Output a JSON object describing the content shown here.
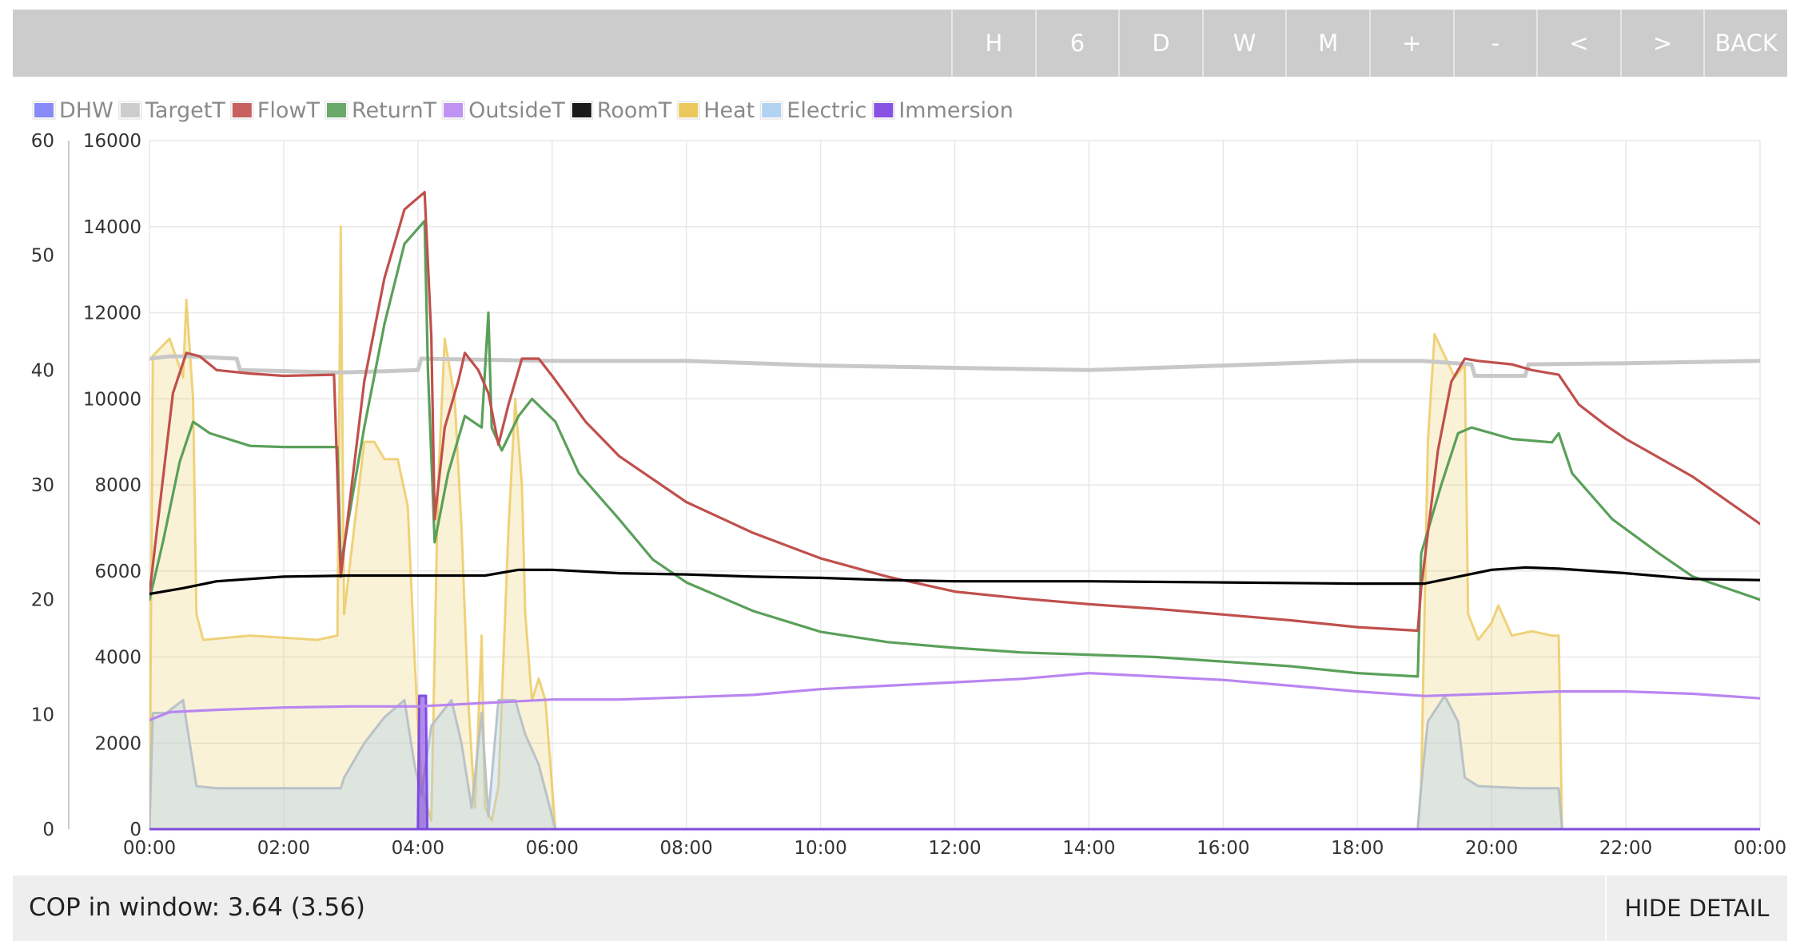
{
  "toolbar": {
    "buttons": [
      "H",
      "6",
      "D",
      "W",
      "M",
      "+",
      "-",
      "<",
      ">",
      "BACK"
    ]
  },
  "footer": {
    "cop_text": "COP in window: 3.64 (3.56)",
    "hide_label": "HIDE DETAIL"
  },
  "chart_data": {
    "type": "line",
    "title": "",
    "xlabel": "",
    "ylabel": "",
    "x_unit": "hours",
    "xlim": [
      0,
      24
    ],
    "x_ticks": [
      "00:00",
      "02:00",
      "04:00",
      "06:00",
      "08:00",
      "10:00",
      "12:00",
      "14:00",
      "16:00",
      "18:00",
      "20:00",
      "22:00",
      "00:00"
    ],
    "y_left": {
      "range": [
        0,
        60
      ],
      "ticks": [
        "0",
        "10",
        "20",
        "30",
        "40",
        "50",
        "60"
      ]
    },
    "y_right": {
      "range": [
        0,
        16000
      ],
      "ticks": [
        "0",
        "2000",
        "4000",
        "6000",
        "8000",
        "10000",
        "12000",
        "14000",
        "16000"
      ]
    },
    "grid": true,
    "legend_position": "top-left",
    "series": [
      {
        "name": "DHW",
        "color": "#7b7ef5",
        "axis": "left",
        "kind": "line",
        "points": []
      },
      {
        "name": "TargetT",
        "color": "#c8c8c8",
        "axis": "left",
        "kind": "line",
        "points": [
          [
            0,
            41
          ],
          [
            0.3,
            41.2
          ],
          [
            0.6,
            41.2
          ],
          [
            1.3,
            41
          ],
          [
            1.35,
            40
          ],
          [
            2.8,
            39.8
          ],
          [
            2.85,
            39.8
          ],
          [
            3.5,
            39.9
          ],
          [
            4,
            40
          ],
          [
            4.05,
            41
          ],
          [
            6,
            40.8
          ],
          [
            8,
            40.8
          ],
          [
            10,
            40.4
          ],
          [
            12,
            40.2
          ],
          [
            14,
            40
          ],
          [
            16,
            40.4
          ],
          [
            18,
            40.8
          ],
          [
            18.9,
            40.8
          ],
          [
            18.95,
            40.8
          ],
          [
            19.7,
            40.5
          ],
          [
            19.75,
            39.5
          ],
          [
            20.5,
            39.5
          ],
          [
            20.55,
            40.5
          ],
          [
            22,
            40.6
          ],
          [
            24,
            40.8
          ]
        ]
      },
      {
        "name": "FlowT",
        "color": "#c0504d",
        "axis": "left",
        "kind": "line",
        "points": [
          [
            0,
            20.5
          ],
          [
            0.15,
            28
          ],
          [
            0.35,
            38
          ],
          [
            0.55,
            41.5
          ],
          [
            0.75,
            41.2
          ],
          [
            1,
            40
          ],
          [
            1.5,
            39.7
          ],
          [
            2,
            39.5
          ],
          [
            2.75,
            39.6
          ],
          [
            2.85,
            22
          ],
          [
            3.2,
            39
          ],
          [
            3.5,
            48
          ],
          [
            3.8,
            54
          ],
          [
            4.1,
            55.5
          ],
          [
            4.2,
            43
          ],
          [
            4.25,
            27
          ],
          [
            4.4,
            35
          ],
          [
            4.6,
            39
          ],
          [
            4.7,
            41.5
          ],
          [
            4.9,
            40
          ],
          [
            5.05,
            38
          ],
          [
            5.2,
            33.5
          ],
          [
            5.35,
            37
          ],
          [
            5.55,
            41
          ],
          [
            5.8,
            41
          ],
          [
            6,
            39.5
          ],
          [
            6.5,
            35.5
          ],
          [
            7,
            32.5
          ],
          [
            8,
            28.5
          ],
          [
            9,
            25.8
          ],
          [
            10,
            23.6
          ],
          [
            11,
            22
          ],
          [
            12,
            20.7
          ],
          [
            13,
            20.1
          ],
          [
            14,
            19.6
          ],
          [
            15,
            19.2
          ],
          [
            16,
            18.7
          ],
          [
            17,
            18.2
          ],
          [
            18,
            17.6
          ],
          [
            18.9,
            17.3
          ],
          [
            18.95,
            21
          ],
          [
            19.2,
            33
          ],
          [
            19.4,
            39
          ],
          [
            19.6,
            41
          ],
          [
            19.8,
            40.8
          ],
          [
            20.3,
            40.5
          ],
          [
            20.6,
            40
          ],
          [
            21,
            39.6
          ],
          [
            21.3,
            37
          ],
          [
            21.7,
            35.2
          ],
          [
            22,
            34
          ],
          [
            23,
            30.7
          ],
          [
            24,
            26.6
          ]
        ]
      },
      {
        "name": "ReturnT",
        "color": "#5aa05a",
        "axis": "left",
        "kind": "line",
        "points": [
          [
            0,
            20
          ],
          [
            0.2,
            25
          ],
          [
            0.45,
            32
          ],
          [
            0.65,
            35.5
          ],
          [
            0.9,
            34.5
          ],
          [
            1.5,
            33.4
          ],
          [
            2,
            33.3
          ],
          [
            2.8,
            33.3
          ],
          [
            2.85,
            23
          ],
          [
            3.2,
            35
          ],
          [
            3.5,
            44
          ],
          [
            3.8,
            51
          ],
          [
            4.1,
            53
          ],
          [
            4.15,
            40
          ],
          [
            4.25,
            25
          ],
          [
            4.45,
            31
          ],
          [
            4.7,
            36
          ],
          [
            4.95,
            35
          ],
          [
            5.05,
            45
          ],
          [
            5.1,
            35
          ],
          [
            5.25,
            33
          ],
          [
            5.5,
            36
          ],
          [
            5.7,
            37.5
          ],
          [
            6.05,
            35.5
          ],
          [
            6.4,
            31
          ],
          [
            7,
            27
          ],
          [
            7.5,
            23.5
          ],
          [
            8,
            21.5
          ],
          [
            9,
            19
          ],
          [
            10,
            17.2
          ],
          [
            11,
            16.3
          ],
          [
            12,
            15.8
          ],
          [
            13,
            15.4
          ],
          [
            14,
            15.2
          ],
          [
            15,
            15
          ],
          [
            16,
            14.6
          ],
          [
            17,
            14.2
          ],
          [
            18,
            13.6
          ],
          [
            18.9,
            13.3
          ],
          [
            18.95,
            24
          ],
          [
            19.25,
            30
          ],
          [
            19.5,
            34.5
          ],
          [
            19.7,
            35
          ],
          [
            20.3,
            34
          ],
          [
            20.9,
            33.7
          ],
          [
            21,
            34.5
          ],
          [
            21.2,
            31
          ],
          [
            21.8,
            27
          ],
          [
            22.5,
            24
          ],
          [
            23,
            22
          ],
          [
            24,
            20
          ]
        ]
      },
      {
        "name": "OutsideT",
        "color": "#b986f0",
        "axis": "left",
        "kind": "line",
        "points": [
          [
            0,
            9.5
          ],
          [
            0.3,
            10.2
          ],
          [
            1,
            10.4
          ],
          [
            2,
            10.6
          ],
          [
            3,
            10.7
          ],
          [
            4,
            10.7
          ],
          [
            5,
            11
          ],
          [
            6,
            11.3
          ],
          [
            7,
            11.3
          ],
          [
            8,
            11.5
          ],
          [
            9,
            11.7
          ],
          [
            10,
            12.2
          ],
          [
            11,
            12.5
          ],
          [
            12,
            12.8
          ],
          [
            13,
            13.1
          ],
          [
            14,
            13.6
          ],
          [
            15,
            13.3
          ],
          [
            16,
            13
          ],
          [
            17,
            12.5
          ],
          [
            18,
            12
          ],
          [
            19,
            11.6
          ],
          [
            20,
            11.8
          ],
          [
            21,
            12
          ],
          [
            22,
            12
          ],
          [
            23,
            11.8
          ],
          [
            24,
            11.4
          ]
        ]
      },
      {
        "name": "RoomT",
        "color": "#000000",
        "axis": "left",
        "kind": "line",
        "points": [
          [
            0,
            20.5
          ],
          [
            0.5,
            21
          ],
          [
            1,
            21.6
          ],
          [
            2,
            22
          ],
          [
            3,
            22.1
          ],
          [
            4,
            22.1
          ],
          [
            5,
            22.1
          ],
          [
            5.5,
            22.6
          ],
          [
            6,
            22.6
          ],
          [
            7,
            22.3
          ],
          [
            8,
            22.2
          ],
          [
            9,
            22
          ],
          [
            10,
            21.9
          ],
          [
            11,
            21.7
          ],
          [
            12,
            21.6
          ],
          [
            14,
            21.6
          ],
          [
            16,
            21.5
          ],
          [
            18,
            21.4
          ],
          [
            19,
            21.4
          ],
          [
            19.5,
            22
          ],
          [
            20,
            22.6
          ],
          [
            20.5,
            22.8
          ],
          [
            21,
            22.7
          ],
          [
            22,
            22.3
          ],
          [
            23,
            21.8
          ],
          [
            24,
            21.7
          ]
        ]
      },
      {
        "name": "Heat",
        "color": "#e8c24a",
        "axis": "right",
        "kind": "area",
        "points": [
          [
            0,
            0
          ],
          [
            0.05,
            11000
          ],
          [
            0.3,
            11400
          ],
          [
            0.5,
            10500
          ],
          [
            0.55,
            12300
          ],
          [
            0.65,
            10000
          ],
          [
            0.7,
            5000
          ],
          [
            0.8,
            4400
          ],
          [
            1.5,
            4500
          ],
          [
            2.5,
            4400
          ],
          [
            2.8,
            4500
          ],
          [
            2.85,
            14000
          ],
          [
            2.9,
            5000
          ],
          [
            3.2,
            9000
          ],
          [
            3.35,
            9000
          ],
          [
            3.5,
            8600
          ],
          [
            3.7,
            8600
          ],
          [
            3.85,
            7500
          ],
          [
            3.95,
            4000
          ],
          [
            4.05,
            1000
          ],
          [
            4.2,
            200
          ],
          [
            4.3,
            8000
          ],
          [
            4.4,
            11400
          ],
          [
            4.55,
            10000
          ],
          [
            4.65,
            7000
          ],
          [
            4.75,
            3000
          ],
          [
            4.85,
            500
          ],
          [
            4.95,
            4500
          ],
          [
            5,
            500
          ],
          [
            5.1,
            200
          ],
          [
            5.2,
            1000
          ],
          [
            5.35,
            7000
          ],
          [
            5.45,
            10000
          ],
          [
            5.55,
            8000
          ],
          [
            5.6,
            5000
          ],
          [
            5.7,
            3000
          ],
          [
            5.8,
            3500
          ],
          [
            5.9,
            3000
          ],
          [
            6.05,
            0
          ],
          [
            18.9,
            0
          ],
          [
            18.95,
            1000
          ],
          [
            19.05,
            9000
          ],
          [
            19.15,
            11500
          ],
          [
            19.3,
            11000
          ],
          [
            19.45,
            10500
          ],
          [
            19.6,
            10800
          ],
          [
            19.65,
            5000
          ],
          [
            19.8,
            4400
          ],
          [
            20,
            4800
          ],
          [
            20.1,
            5200
          ],
          [
            20.3,
            4500
          ],
          [
            20.6,
            4600
          ],
          [
            20.9,
            4500
          ],
          [
            21,
            4500
          ],
          [
            21.05,
            0
          ],
          [
            24,
            0
          ]
        ]
      },
      {
        "name": "Electric",
        "color": "#a8cdef",
        "axis": "right",
        "kind": "area",
        "points": [
          [
            0,
            0
          ],
          [
            0.05,
            2700
          ],
          [
            0.25,
            2700
          ],
          [
            0.5,
            3000
          ],
          [
            0.6,
            2000
          ],
          [
            0.7,
            1000
          ],
          [
            1,
            950
          ],
          [
            2,
            950
          ],
          [
            2.85,
            950
          ],
          [
            2.9,
            1200
          ],
          [
            3.2,
            2000
          ],
          [
            3.5,
            2600
          ],
          [
            3.8,
            3000
          ],
          [
            3.95,
            1500
          ],
          [
            4.05,
            800
          ],
          [
            4.2,
            2400
          ],
          [
            4.5,
            3000
          ],
          [
            4.65,
            2000
          ],
          [
            4.8,
            500
          ],
          [
            4.95,
            2700
          ],
          [
            5.05,
            300
          ],
          [
            5.2,
            3000
          ],
          [
            5.45,
            3000
          ],
          [
            5.6,
            2200
          ],
          [
            5.8,
            1500
          ],
          [
            6.05,
            0
          ],
          [
            18.9,
            0
          ],
          [
            18.95,
            1000
          ],
          [
            19.05,
            2500
          ],
          [
            19.3,
            3100
          ],
          [
            19.5,
            2500
          ],
          [
            19.6,
            1200
          ],
          [
            19.8,
            1000
          ],
          [
            20.5,
            950
          ],
          [
            21,
            950
          ],
          [
            21.05,
            0
          ],
          [
            24,
            0
          ]
        ]
      },
      {
        "name": "Immersion",
        "color": "#7a3fe0",
        "axis": "right",
        "kind": "area",
        "points": [
          [
            0,
            0
          ],
          [
            4.0,
            0
          ],
          [
            4.02,
            3100
          ],
          [
            4.12,
            3100
          ],
          [
            4.14,
            0
          ],
          [
            24,
            0
          ]
        ]
      }
    ]
  }
}
